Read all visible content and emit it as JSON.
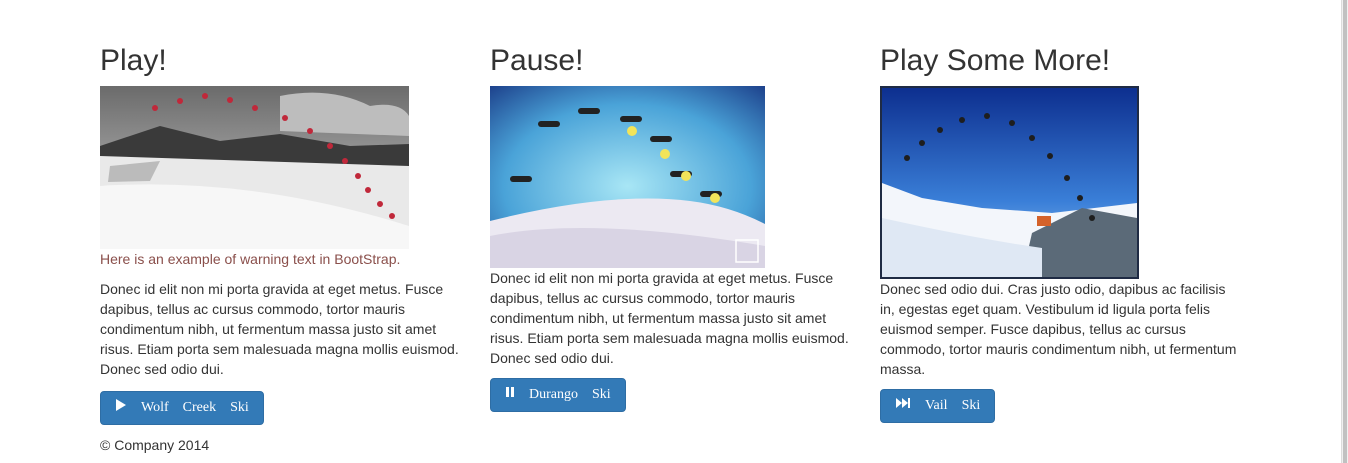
{
  "columns": [
    {
      "heading": "Play!",
      "warning": "Here is an example of warning text in BootStrap.",
      "body": "Donec id elit non mi porta gravida at eget metus. Fusce dapibus, tellus ac cursus commodo, tortor mauris condimentum nibh, ut fermentum massa justo sit amet risus. Etiam porta sem malesuada magna mollis euismod. Donec sed odio dui.",
      "button_words": [
        "Wolf",
        "Creek",
        "Ski"
      ],
      "button_icon": "play-icon"
    },
    {
      "heading": "Pause!",
      "body": "Donec id elit non mi porta gravida at eget metus. Fusce dapibus, tellus ac cursus commodo, tortor mauris condimentum nibh, ut fermentum massa justo sit amet risus. Etiam porta sem malesuada magna mollis euismod. Donec sed odio dui.",
      "button_words": [
        "Durango",
        "Ski"
      ],
      "button_icon": "pause-icon"
    },
    {
      "heading": "Play Some More!",
      "body": "Donec sed odio dui. Cras justo odio, dapibus ac facilisis in, egestas eget quam. Vestibulum id ligula porta felis euismod semper. Fusce dapibus, tellus ac cursus commodo, tortor mauris condimentum nibh, ut fermentum massa.",
      "button_words": [
        "Vail",
        "Ski"
      ],
      "button_icon": "fast-forward-icon"
    }
  ],
  "footer": "© Company 2014",
  "colors": {
    "primary_button": "#337ab7",
    "warning_text": "#8a4f4b",
    "text": "#333333"
  }
}
